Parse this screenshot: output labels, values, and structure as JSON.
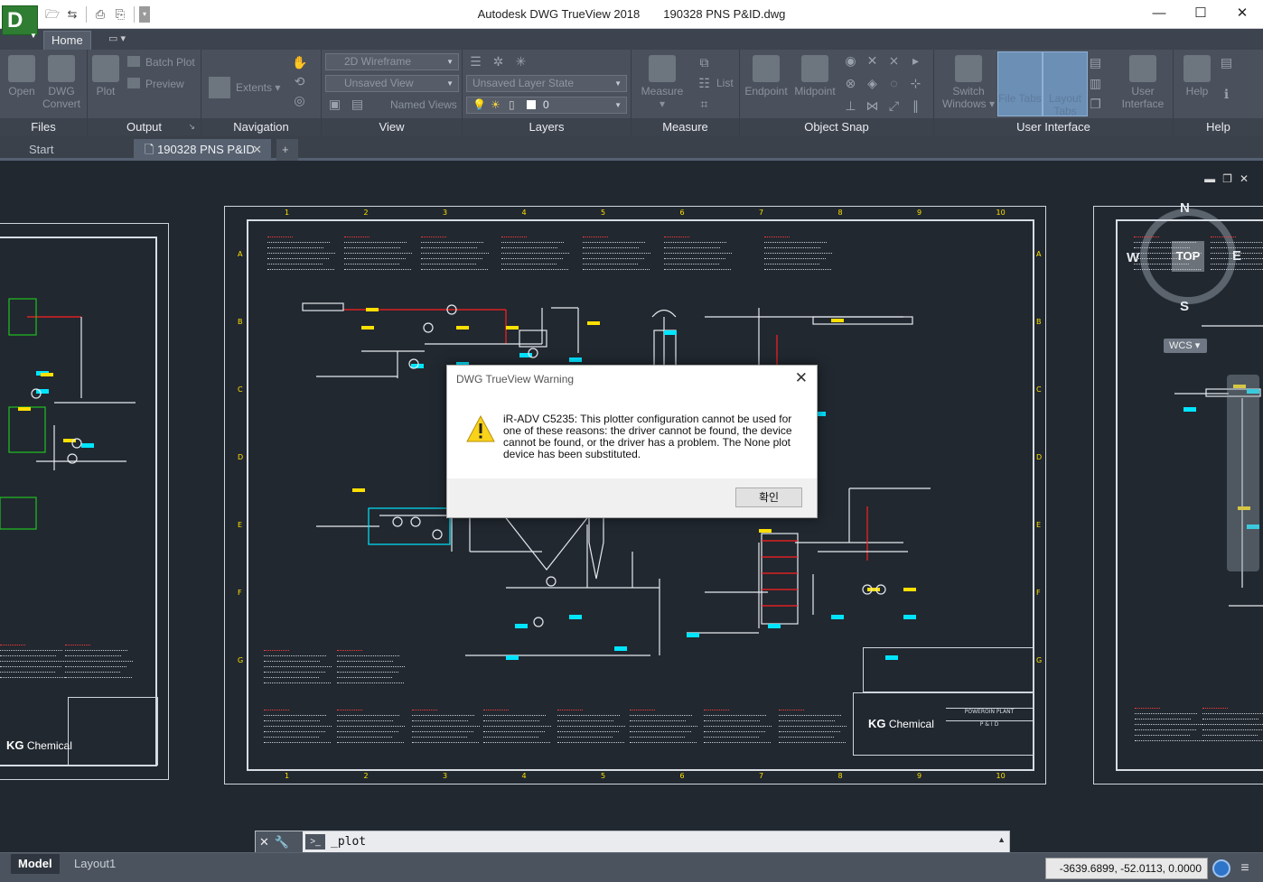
{
  "window": {
    "app_name": "Autodesk DWG TrueView 2018",
    "file_name": "190328 PNS P&ID.dwg",
    "logo_letter": "D"
  },
  "ribbon": {
    "tabs": {
      "home": "Home"
    },
    "panels": {
      "files": "Files",
      "output": "Output",
      "navigation": "Navigation",
      "view": "View",
      "layers": "Layers",
      "measure": "Measure",
      "object_snap": "Object Snap",
      "user_interface": "User Interface",
      "help": "Help"
    },
    "buttons": {
      "open": "Open",
      "dwg_convert_1": "DWG",
      "dwg_convert_2": "Convert",
      "plot": "Plot",
      "batch_plot": "Batch Plot",
      "preview": "Preview",
      "extents": "Extents",
      "measure": "Measure",
      "list": "List",
      "endpoint": "Endpoint",
      "midpoint": "Midpoint",
      "switch_windows_1": "Switch",
      "switch_windows_2": "Windows",
      "file_tabs_1": "File Tabs",
      "layout_tabs_1": "Layout",
      "layout_tabs_2": "Tabs",
      "user_interface_1": "User",
      "user_interface_2": "Interface",
      "help": "Help"
    },
    "combos": {
      "visual_style": "2D Wireframe",
      "view": "Unsaved View",
      "named_views": "Named Views",
      "layer_state": "Unsaved Layer State",
      "layer_current": "0"
    }
  },
  "doc_tabs": {
    "start": "Start",
    "active": "190328 PNS P&ID",
    "close": "✕",
    "add": "+"
  },
  "drawing": {
    "columns": [
      "1",
      "2",
      "3",
      "4",
      "5",
      "6",
      "7",
      "8",
      "9",
      "10"
    ],
    "rows": [
      "A",
      "B",
      "C",
      "D",
      "E",
      "F",
      "G"
    ],
    "company": "Chemical",
    "company_mark": "KG",
    "tb_project": "POWEROIN PLANT",
    "tb_title": "P & I D"
  },
  "viewcube": {
    "top": "TOP",
    "north": "N",
    "south": "S",
    "east": "E",
    "west": "W",
    "wcs": "WCS"
  },
  "dialog": {
    "title": "DWG TrueView Warning",
    "message": "iR-ADV C5235: This plotter configuration cannot be used for one of these reasons: the driver cannot be found, the device cannot be found, or the driver has a problem. The None plot device has been substituted.",
    "ok": "확인",
    "close": "✕"
  },
  "command": {
    "text": "_plot"
  },
  "status": {
    "model": "Model",
    "layout": "Layout1",
    "coordinates": "-3639.6899, -52.0113, 0.0000"
  },
  "colors": {
    "canvas": "#212830",
    "accent": "#ffe000",
    "pipe_red": "#ff2020",
    "instrument_cyan": "#00e5ff",
    "logo_green": "#2e7d32"
  }
}
